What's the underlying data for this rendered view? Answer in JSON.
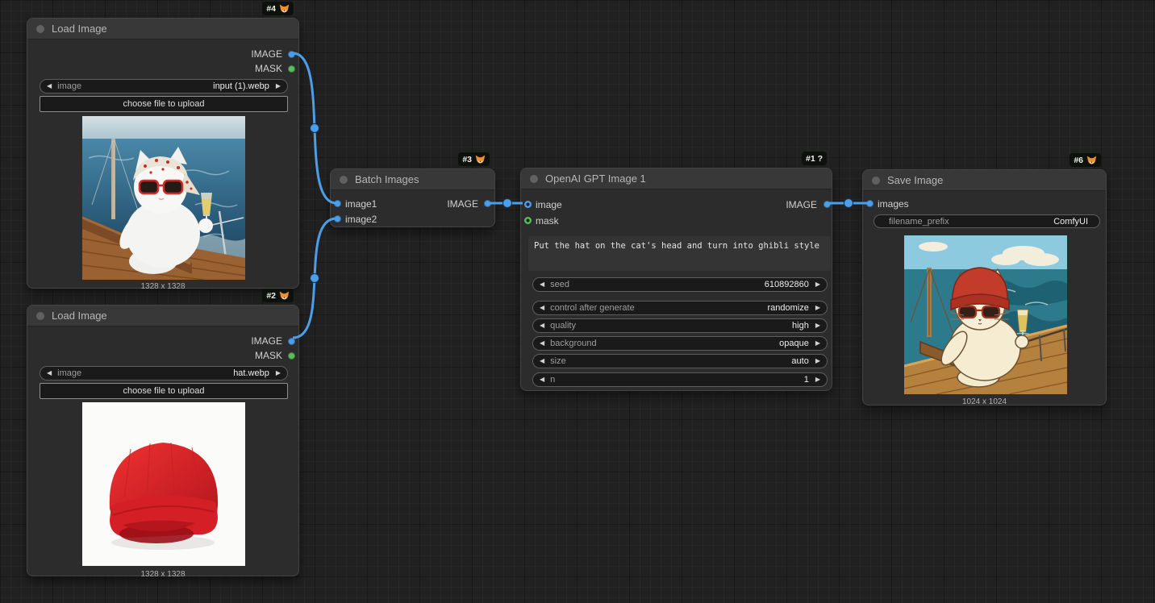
{
  "ui": {
    "arrow_left": "◀",
    "arrow_right": "▶",
    "link_color": "#4d9ee8",
    "image_port_color": "#4d9ee8",
    "mask_port_color": "#59bd5f"
  },
  "nodes": {
    "load1": {
      "badge": "#4",
      "badge_icon": "fox-icon",
      "title": "Load Image",
      "out_image": "IMAGE",
      "out_mask": "MASK",
      "widget_label": "image",
      "widget_value": "input (1).webp",
      "upload": "choose file to upload",
      "caption": "1328 x 1328",
      "preview_alt": "white cat with red sunglasses and floral bandana holding champagne on a sailboat"
    },
    "load2": {
      "badge": "#2",
      "badge_icon": "fox-icon",
      "title": "Load Image",
      "out_image": "IMAGE",
      "out_mask": "MASK",
      "widget_label": "image",
      "widget_value": "hat.webp",
      "upload": "choose file to upload",
      "caption": "1328 x 1328",
      "preview_alt": "red knit beanie hat on white background"
    },
    "batch": {
      "badge": "#3",
      "badge_icon": "fox-icon",
      "title": "Batch Images",
      "in1": "image1",
      "in2": "image2",
      "out": "IMAGE"
    },
    "gpt": {
      "badge": "#1 ?",
      "title": "OpenAI GPT Image 1",
      "in1": "image",
      "in2": "mask",
      "out": "IMAGE",
      "prompt": "Put the hat on the cat's head and turn into ghibli style",
      "params": [
        {
          "label": "seed",
          "value": "610892860"
        },
        {
          "label": "control after generate",
          "value": "randomize"
        },
        {
          "label": "quality",
          "value": "high"
        },
        {
          "label": "background",
          "value": "opaque"
        },
        {
          "label": "size",
          "value": "auto"
        },
        {
          "label": "n",
          "value": "1"
        }
      ]
    },
    "save": {
      "badge": "#6",
      "badge_icon": "fox-icon",
      "title": "Save Image",
      "in1": "images",
      "widget_label": "filename_prefix",
      "widget_value": "ComfyUI",
      "caption": "1024 x 1024",
      "preview_alt": "ghibli style cream cat wearing red beanie and sunglasses holding champagne on a boat"
    }
  }
}
